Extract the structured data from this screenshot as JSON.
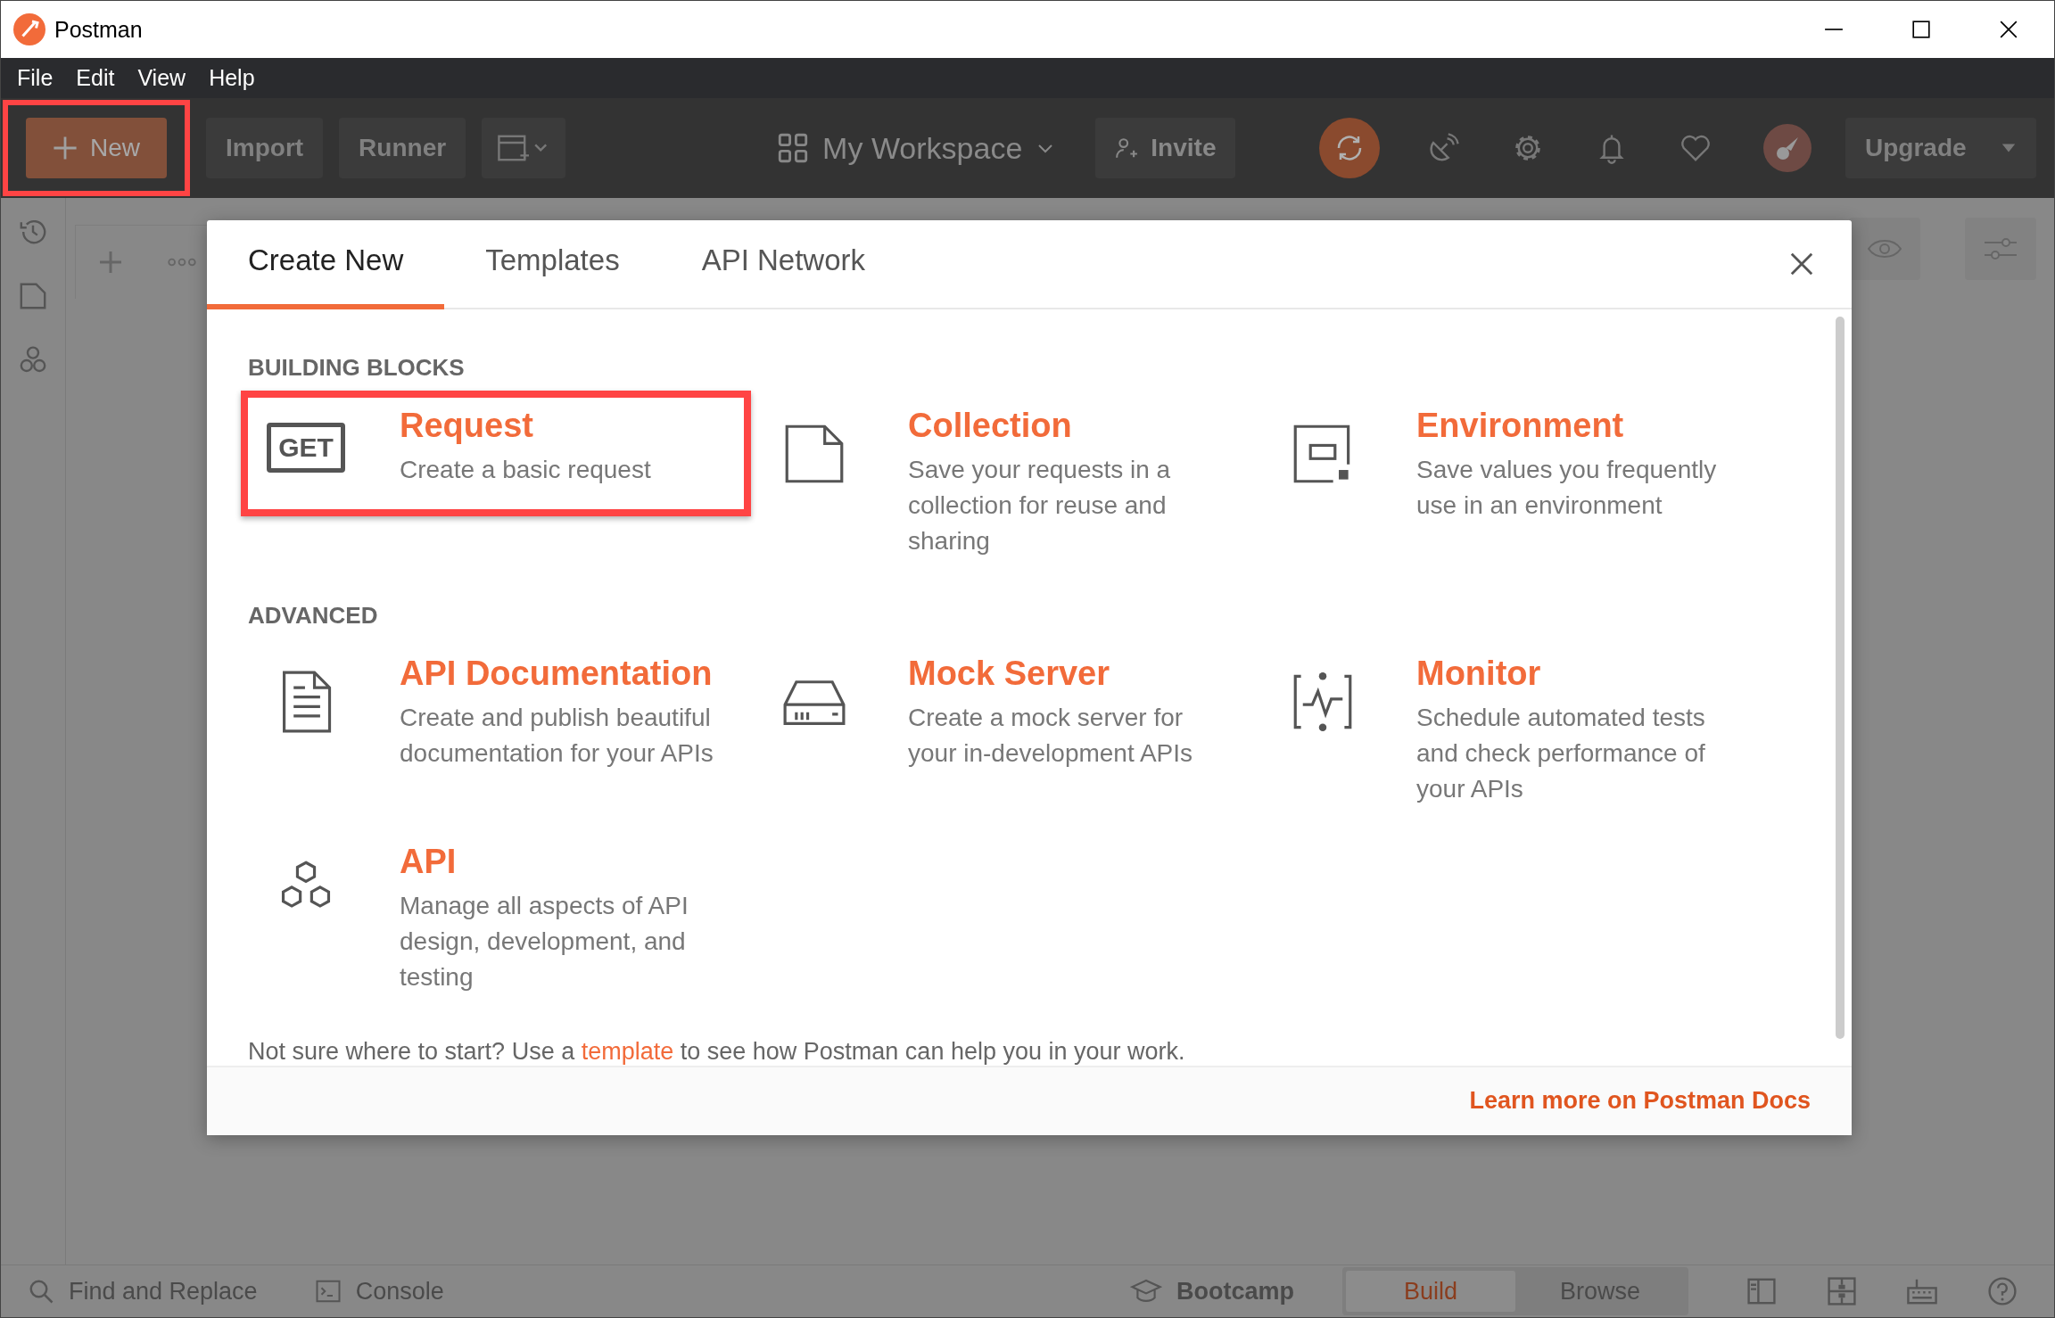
{
  "window": {
    "title": "Postman"
  },
  "menu": [
    "File",
    "Edit",
    "View",
    "Help"
  ],
  "toolbar": {
    "new": "New",
    "new_highlighted": true,
    "import": "Import",
    "runner": "Runner",
    "workspace": "My Workspace",
    "invite": "Invite",
    "upgrade": "Upgrade"
  },
  "dialog": {
    "tabs": [
      {
        "label": "Create New",
        "selected": true
      },
      {
        "label": "Templates",
        "selected": false
      },
      {
        "label": "API Network",
        "selected": false
      }
    ],
    "sections": [
      {
        "title": "BUILDING BLOCKS",
        "items": [
          {
            "kind": "request",
            "icon_text": "GET",
            "title": "Request",
            "description": "Create a basic request",
            "highlighted": true
          },
          {
            "kind": "collection",
            "title": "Collection",
            "description": "Save your requests in a collection for reuse and sharing",
            "highlighted": false
          },
          {
            "kind": "environment",
            "title": "Environment",
            "description": "Save values you frequently use in an environment",
            "highlighted": false
          }
        ]
      },
      {
        "title": "ADVANCED",
        "items": [
          {
            "kind": "documentation",
            "title": "API Documentation",
            "description": "Create and publish beautiful documentation for your APIs",
            "highlighted": false
          },
          {
            "kind": "mock",
            "title": "Mock Server",
            "description": "Create a mock server for your in-development APIs",
            "highlighted": false
          },
          {
            "kind": "monitor",
            "title": "Monitor",
            "description": "Schedule automated tests and check performance of your APIs",
            "highlighted": false
          },
          {
            "kind": "api",
            "title": "API",
            "description": "Manage all aspects of API design, development, and testing",
            "highlighted": false
          }
        ]
      }
    ],
    "hint": {
      "before": "Not sure where to start? Use a ",
      "link": "template",
      "after": " to see how Postman can help you in your work."
    },
    "footer_link": "Learn more on Postman Docs"
  },
  "status_bar": {
    "find": "Find and Replace",
    "console": "Console",
    "bootcamp": "Bootcamp",
    "modes": [
      {
        "label": "Build",
        "selected": true
      },
      {
        "label": "Browse",
        "selected": false
      }
    ]
  }
}
